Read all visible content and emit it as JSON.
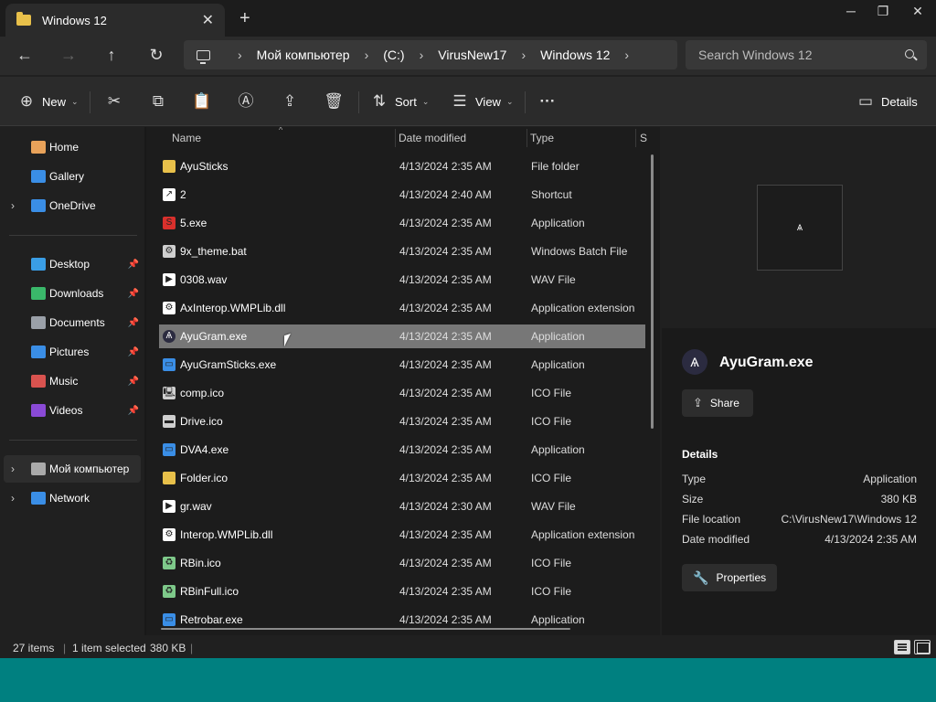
{
  "window": {
    "tab_title": "Windows 12",
    "new_tab": "+",
    "controls": {
      "minimize": "─",
      "maximize": "❐",
      "close": "✕"
    }
  },
  "nav": {
    "back": "←",
    "forward": "→",
    "up": "↑",
    "refresh": "↻"
  },
  "address": {
    "breadcrumbs": [
      "Мой компьютер",
      "(C:)",
      "VirusNew17",
      "Windows 12"
    ],
    "separator": "›",
    "search_placeholder": "Search Windows 12"
  },
  "commands": {
    "new_label": "New",
    "sort_label": "Sort",
    "view_label": "View",
    "more_label": "···",
    "details_label": "Details",
    "icons": {
      "new": "⊕",
      "cut": "✂",
      "copy": "⧉",
      "paste": "📋",
      "rename": "Ⓐ",
      "share": "⇪",
      "delete": "🗑",
      "sort": "⇅",
      "view": "☰",
      "details": "▭"
    }
  },
  "sidebar": {
    "quick": [
      {
        "label": "Home",
        "icon": "home-icon",
        "color": "#e8a25a"
      },
      {
        "label": "Gallery",
        "icon": "gallery-icon",
        "color": "#3a8ee6"
      },
      {
        "label": "OneDrive",
        "icon": "cloud-icon",
        "color": "#3a8ee6"
      }
    ],
    "pinned": [
      {
        "label": "Desktop",
        "icon": "desktop-icon",
        "color": "#3a9ee6"
      },
      {
        "label": "Downloads",
        "icon": "download-icon",
        "color": "#3ab86a"
      },
      {
        "label": "Documents",
        "icon": "documents-icon",
        "color": "#9aa0a8"
      },
      {
        "label": "Pictures",
        "icon": "pictures-icon",
        "color": "#3a8ee6"
      },
      {
        "label": "Music",
        "icon": "music-icon",
        "color": "#d9534f"
      },
      {
        "label": "Videos",
        "icon": "videos-icon",
        "color": "#8a4ad6"
      }
    ],
    "devices": [
      {
        "label": "Мой компьютер",
        "icon": "computer-icon",
        "color": "#aaaaaa"
      },
      {
        "label": "Network",
        "icon": "network-icon",
        "color": "#3a8ee6"
      }
    ],
    "pin_glyph": "📌"
  },
  "list": {
    "columns": [
      "Name",
      "Date modified",
      "Type",
      "S"
    ],
    "files": [
      {
        "name": "AyuSticks",
        "date": "4/13/2024 2:35 AM",
        "type": "File folder",
        "icon": "folder-icon",
        "color": "#e8c04a",
        "glyph": ""
      },
      {
        "name": "2",
        "date": "4/13/2024 2:40 AM",
        "type": "Shortcut",
        "icon": "shortcut-icon",
        "color": "#ffffff",
        "glyph": "↗"
      },
      {
        "name": "5.exe",
        "date": "4/13/2024 2:35 AM",
        "type": "Application",
        "icon": "app-red-icon",
        "color": "#d9302c",
        "glyph": "S"
      },
      {
        "name": "9x_theme.bat",
        "date": "4/13/2024 2:35 AM",
        "type": "Windows Batch File",
        "icon": "batch-icon",
        "color": "#cfcfcf",
        "glyph": "⚙"
      },
      {
        "name": "0308.wav",
        "date": "4/13/2024 2:35 AM",
        "type": "WAV File",
        "icon": "audio-icon",
        "color": "#ffffff",
        "glyph": "▶"
      },
      {
        "name": "AxInterop.WMPLib.dll",
        "date": "4/13/2024 2:35 AM",
        "type": "Application extension",
        "icon": "dll-icon",
        "color": "#ffffff",
        "glyph": "⚙"
      },
      {
        "name": "AyuGram.exe",
        "date": "4/13/2024 2:35 AM",
        "type": "Application",
        "icon": "ayugram-icon",
        "color": "#2b2b40",
        "glyph": "Ѧ"
      },
      {
        "name": "AyuGramSticks.exe",
        "date": "4/13/2024 2:35 AM",
        "type": "Application",
        "icon": "app-window-icon",
        "color": "#3a8ee6",
        "glyph": "▭"
      },
      {
        "name": "comp.ico",
        "date": "4/13/2024 2:35 AM",
        "type": "ICO File",
        "icon": "computer-icon",
        "color": "#cfcfcf",
        "glyph": "🖳"
      },
      {
        "name": "Drive.ico",
        "date": "4/13/2024 2:35 AM",
        "type": "ICO File",
        "icon": "drive-icon",
        "color": "#cfcfcf",
        "glyph": "▬"
      },
      {
        "name": "DVA4.exe",
        "date": "4/13/2024 2:35 AM",
        "type": "Application",
        "icon": "app-window-icon",
        "color": "#3a8ee6",
        "glyph": "▭"
      },
      {
        "name": "Folder.ico",
        "date": "4/13/2024 2:35 AM",
        "type": "ICO File",
        "icon": "folder-icon",
        "color": "#e8c04a",
        "glyph": ""
      },
      {
        "name": "gr.wav",
        "date": "4/13/2024 2:30 AM",
        "type": "WAV File",
        "icon": "audio-icon",
        "color": "#ffffff",
        "glyph": "▶"
      },
      {
        "name": "Interop.WMPLib.dll",
        "date": "4/13/2024 2:35 AM",
        "type": "Application extension",
        "icon": "dll-icon",
        "color": "#ffffff",
        "glyph": "⚙"
      },
      {
        "name": "RBin.ico",
        "date": "4/13/2024 2:35 AM",
        "type": "ICO File",
        "icon": "recycle-bin-icon",
        "color": "#7ec98a",
        "glyph": "♻"
      },
      {
        "name": "RBinFull.ico",
        "date": "4/13/2024 2:35 AM",
        "type": "ICO File",
        "icon": "recycle-bin-icon",
        "color": "#7ec98a",
        "glyph": "♻"
      },
      {
        "name": "Retrobar.exe",
        "date": "4/13/2024 2:35 AM",
        "type": "Application",
        "icon": "app-window-icon",
        "color": "#3a8ee6",
        "glyph": "▭"
      }
    ],
    "selected_index": 6
  },
  "details": {
    "file_name": "AyuGram.exe",
    "share_label": "Share",
    "section_title": "Details",
    "props": [
      {
        "label": "Type",
        "value": "Application"
      },
      {
        "label": "Size",
        "value": "380 KB"
      },
      {
        "label": "File location",
        "value": "C:\\VirusNew17\\Windows 12"
      },
      {
        "label": "Date modified",
        "value": "4/13/2024 2:35 AM"
      }
    ],
    "properties_label": "Properties"
  },
  "status": {
    "item_count": "27 items",
    "selection": "1 item selected",
    "size": "380 KB"
  }
}
